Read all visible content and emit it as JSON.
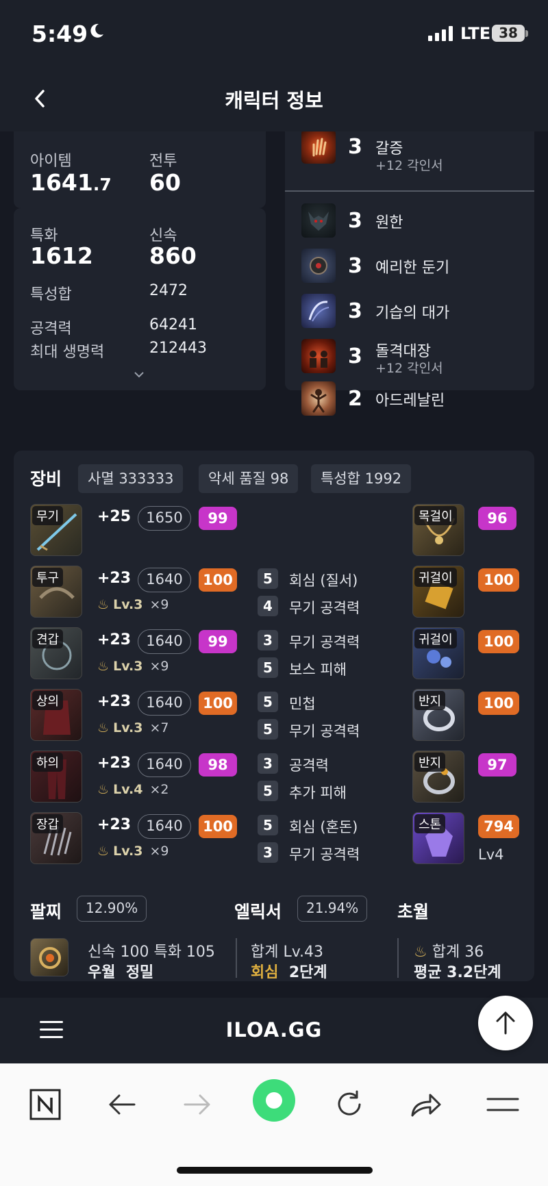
{
  "status": {
    "time": "5:49",
    "network": "LTE",
    "battery": "38"
  },
  "header": {
    "title": "캐릭터 정보"
  },
  "stats_top": {
    "item_label": "아이템",
    "item_value_main": "1641",
    "item_value_decimal": ".7",
    "combat_label": "전투",
    "combat_value": "60"
  },
  "stats": {
    "spec_label": "특화",
    "spec_value": "1612",
    "swift_label": "신속",
    "swift_value": "860",
    "trait_sum_label": "특성합",
    "trait_sum_value": "2472",
    "atk_label": "공격력",
    "atk_value": "64241",
    "hp_label": "최대 생명력",
    "hp_value": "212443"
  },
  "engravings": [
    {
      "level": "3",
      "name": "갈증",
      "sub": "+12 각인서",
      "icon": "thirst-hand-icon"
    },
    {
      "level": "3",
      "name": "원한",
      "sub": "",
      "icon": "grudge-demon-icon"
    },
    {
      "level": "3",
      "name": "예리한 둔기",
      "sub": "",
      "icon": "keen-blunt-icon"
    },
    {
      "level": "3",
      "name": "기습의 대가",
      "sub": "",
      "icon": "master-ambush-icon"
    },
    {
      "level": "3",
      "name": "돌격대장",
      "sub": "+12 각인서",
      "icon": "raid-captain-icon"
    },
    {
      "level": "2",
      "name": "아드레날린",
      "sub": "",
      "icon": "adrenaline-icon"
    }
  ],
  "equipment": {
    "title": "장비",
    "chips": [
      "사멸 333333",
      "악세 품질 98",
      "특성합 1992"
    ],
    "gear": [
      {
        "slot": "무기",
        "enhance": "+25",
        "ilvl": "1650",
        "quality": "99",
        "quality_color": "#c735c9",
        "elixir_lv": "",
        "elixir_count": "",
        "opts": []
      },
      {
        "slot": "투구",
        "enhance": "+23",
        "ilvl": "1640",
        "quality": "100",
        "quality_color": "#e06b25",
        "elixir_lv": "Lv.3",
        "elixir_count": "×9",
        "opts": [
          {
            "n": "5",
            "name": "회심 (질서)"
          },
          {
            "n": "4",
            "name": "무기 공격력"
          }
        ]
      },
      {
        "slot": "견갑",
        "enhance": "+23",
        "ilvl": "1640",
        "quality": "99",
        "quality_color": "#c735c9",
        "elixir_lv": "Lv.3",
        "elixir_count": "×9",
        "opts": [
          {
            "n": "3",
            "name": "무기 공격력"
          },
          {
            "n": "5",
            "name": "보스 피해"
          }
        ]
      },
      {
        "slot": "상의",
        "enhance": "+23",
        "ilvl": "1640",
        "quality": "100",
        "quality_color": "#e06b25",
        "elixir_lv": "Lv.3",
        "elixir_count": "×7",
        "opts": [
          {
            "n": "5",
            "name": "민첩"
          },
          {
            "n": "5",
            "name": "무기 공격력"
          }
        ]
      },
      {
        "slot": "하의",
        "enhance": "+23",
        "ilvl": "1640",
        "quality": "98",
        "quality_color": "#c735c9",
        "elixir_lv": "Lv.4",
        "elixir_count": "×2",
        "opts": [
          {
            "n": "3",
            "name": "공격력"
          },
          {
            "n": "5",
            "name": "추가 피해"
          }
        ]
      },
      {
        "slot": "장갑",
        "enhance": "+23",
        "ilvl": "1640",
        "quality": "100",
        "quality_color": "#e06b25",
        "elixir_lv": "Lv.3",
        "elixir_count": "×9",
        "opts": [
          {
            "n": "5",
            "name": "회심 (혼돈)"
          },
          {
            "n": "3",
            "name": "무기 공격력"
          }
        ]
      }
    ],
    "accessories": [
      {
        "slot": "목걸이",
        "quality": "96",
        "quality_color": "#c735c9"
      },
      {
        "slot": "귀걸이",
        "quality": "100",
        "quality_color": "#e06b25"
      },
      {
        "slot": "귀걸이",
        "quality": "100",
        "quality_color": "#e06b25"
      },
      {
        "slot": "반지",
        "quality": "100",
        "quality_color": "#e06b25"
      },
      {
        "slot": "반지",
        "quality": "97",
        "quality_color": "#c735c9"
      },
      {
        "slot": "스톤",
        "quality": "794",
        "quality_color": "#e06b25",
        "extra": "Lv4"
      }
    ]
  },
  "bottom": {
    "bracelet_label": "팔찌",
    "bracelet_pct": "12.90%",
    "elixir_label": "엘릭서",
    "elixir_pct": "21.94%",
    "transcend_label": "초월",
    "bracelet_line1": "신속 100  특화 105",
    "bracelet_line2a": "우월",
    "bracelet_line2b": "정밀",
    "elixir_line1": "합계 Lv.43",
    "elixir_line2a": "회심",
    "elixir_line2b": "2단계",
    "transcend_line1": "합계 36",
    "transcend_line2": "평균 3.2단계"
  },
  "footer": {
    "logo": "ILOA.GG"
  },
  "colors": {
    "purple": "#c735c9",
    "orange": "#e06b25",
    "bg": "#161922",
    "card": "#1f232d"
  }
}
